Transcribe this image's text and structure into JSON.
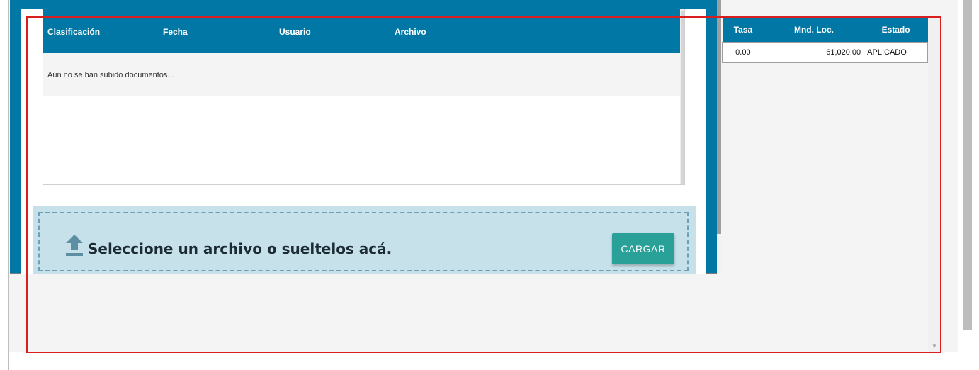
{
  "background_table": {
    "headers": [
      "Tasa",
      "Mnd. Loc.",
      "Estado"
    ],
    "rows": [
      {
        "tasa": "0.00",
        "mnd_loc": "61,020.00",
        "estado": "APLICADO"
      }
    ]
  },
  "modal": {
    "docs_table": {
      "headers": [
        "Clasificación",
        "Fecha",
        "Usuario",
        "Archivo"
      ],
      "empty_message": "Aún no se han subido documentos..."
    },
    "upload": {
      "prompt": "Seleccione un archivo o sueltelos acá.",
      "button_label": "CARGAR",
      "icon": "upload-icon"
    }
  },
  "colors": {
    "header_blue": "#0077a5",
    "upload_zone": "#c6e1ea",
    "button_teal": "#2aa198",
    "highlight_red": "#d81e1e"
  }
}
